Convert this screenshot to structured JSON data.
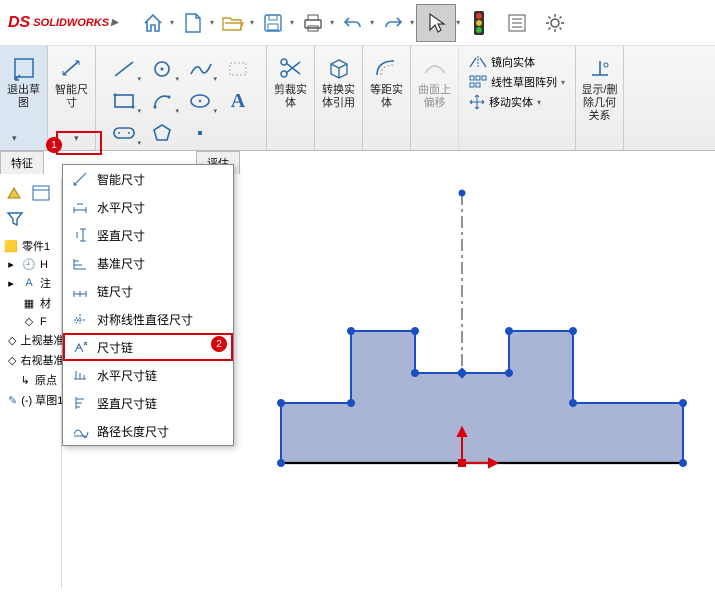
{
  "app": {
    "logo_ds": "DS",
    "logo_name": "SOLIDWORKS"
  },
  "toolbar": {
    "home": "home",
    "new": "new",
    "open": "open",
    "save": "save",
    "print": "print",
    "undo": "undo",
    "redo": "redo",
    "select": "select"
  },
  "ribbon": {
    "exit_sketch": "退出草\n图",
    "smart_dim": "智能尺\n寸",
    "trim": "剪裁实\n体",
    "convert": "转换实\n体引用",
    "offset": "等距实\n体",
    "onsurface": "曲面上\n偏移",
    "show_rel": "显示/删\n除几何\n关系",
    "mirror": "镜向实体",
    "pattern": "线性草图阵列",
    "move": "移动实体"
  },
  "tabs": {
    "left": "特征",
    "right": "评估"
  },
  "menu": {
    "items": [
      "智能尺寸",
      "水平尺寸",
      "竖直尺寸",
      "基准尺寸",
      "链尺寸",
      "对称线性直径尺寸",
      "尺寸链",
      "水平尺寸链",
      "竖直尺寸链",
      "路径长度尺寸"
    ]
  },
  "badges": {
    "one": "1",
    "two": "2"
  },
  "tree": {
    "root": "零件1",
    "items": [
      "H",
      "注",
      "材",
      "F",
      "上视基准面",
      "右视基准面",
      "原点",
      "(-) 草图1"
    ]
  },
  "colors": {
    "accent": "#2a6aa8",
    "sketch_fill": "#aab4d4",
    "sketch_stroke": "#1b4fc1",
    "node": "#1b4fc1"
  }
}
